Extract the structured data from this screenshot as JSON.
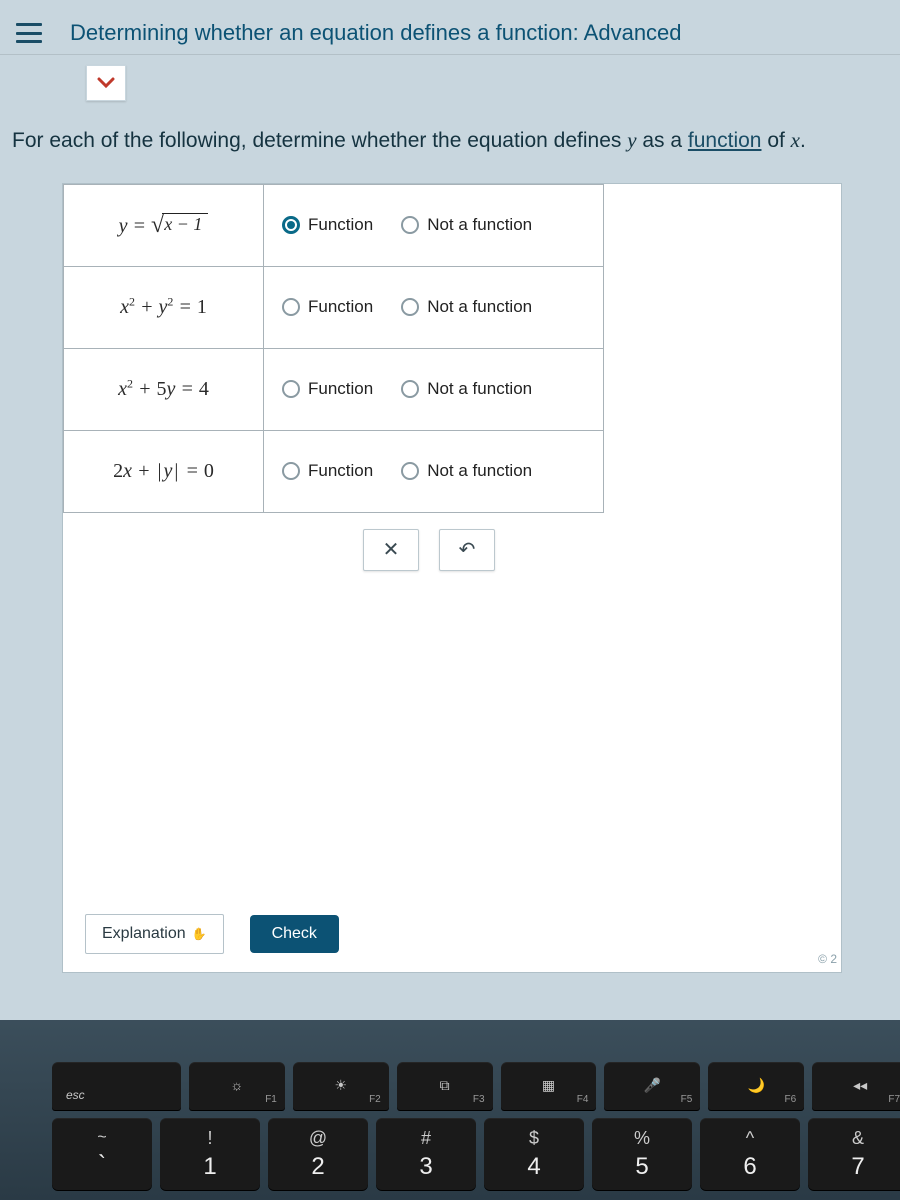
{
  "header": {
    "title": "Determining whether an equation defines a function: Advanced"
  },
  "prompt": {
    "prefix": "For each of the following, determine whether the equation defines ",
    "y": "y",
    "mid": " as a ",
    "link": "function",
    "suffix": " of ",
    "x": "x",
    "period": "."
  },
  "options": {
    "function": "Function",
    "not_function": "Not a function"
  },
  "rows": [
    {
      "eq": "y = √(x − 1)",
      "selected": "function"
    },
    {
      "eq": "x² + y² = 1",
      "selected": null
    },
    {
      "eq": "x² + 5y = 4",
      "selected": null
    },
    {
      "eq": "2x + |y| = 0",
      "selected": null
    }
  ],
  "controls": {
    "clear": "✕",
    "undo": "↶"
  },
  "footer": {
    "explanation": "Explanation",
    "check": "Check",
    "corner": "© 2"
  },
  "keyboard": {
    "fn": [
      {
        "label": "esc",
        "icon": ""
      },
      {
        "label": "F1",
        "icon": "☼"
      },
      {
        "label": "F2",
        "icon": "☀"
      },
      {
        "label": "F3",
        "icon": "⧉"
      },
      {
        "label": "F4",
        "icon": "▦"
      },
      {
        "label": "F5",
        "icon": "🎤"
      },
      {
        "label": "F6",
        "icon": "🌙"
      },
      {
        "label": "F7",
        "icon": "◂◂"
      }
    ],
    "num": [
      {
        "top": "~",
        "bot": "`"
      },
      {
        "top": "!",
        "bot": "1"
      },
      {
        "top": "@",
        "bot": "2"
      },
      {
        "top": "#",
        "bot": "3"
      },
      {
        "top": "$",
        "bot": "4"
      },
      {
        "top": "%",
        "bot": "5"
      },
      {
        "top": "^",
        "bot": "6"
      },
      {
        "top": "&",
        "bot": "7"
      }
    ]
  }
}
